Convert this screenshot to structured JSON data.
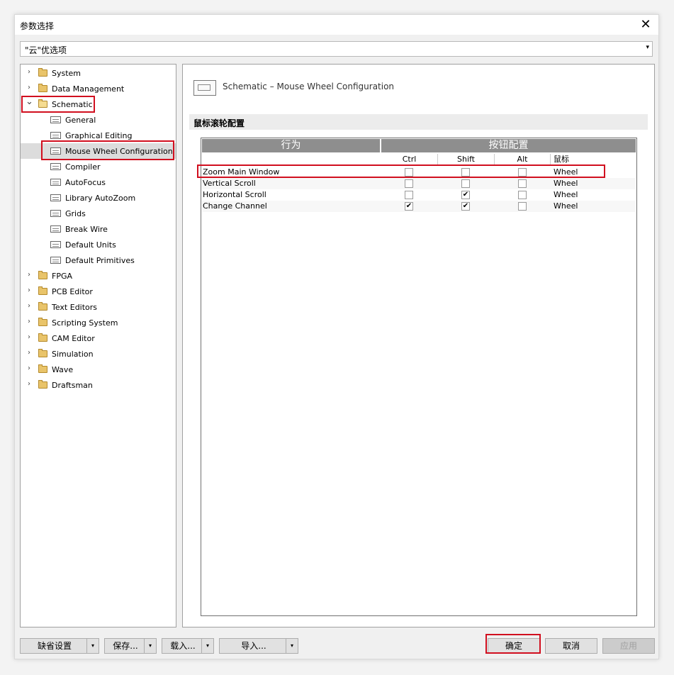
{
  "window": {
    "title": "参数选择",
    "close_glyph": "✕"
  },
  "profile": {
    "value": "\"云\"优选项",
    "arrow": "▾"
  },
  "tree": [
    {
      "label": "System",
      "kind": "folder",
      "level": 0,
      "expand": "collapsed"
    },
    {
      "label": "Data Management",
      "kind": "folder",
      "level": 0,
      "expand": "collapsed"
    },
    {
      "label": "Schematic",
      "kind": "folder",
      "level": 0,
      "expand": "expanded",
      "highlight": true
    },
    {
      "label": "General",
      "kind": "page",
      "level": 1
    },
    {
      "label": "Graphical Editing",
      "kind": "page",
      "level": 1
    },
    {
      "label": "Mouse Wheel Configuration",
      "kind": "page",
      "level": 1,
      "selected": true,
      "highlight": true
    },
    {
      "label": "Compiler",
      "kind": "page",
      "level": 1
    },
    {
      "label": "AutoFocus",
      "kind": "page",
      "level": 1
    },
    {
      "label": "Library AutoZoom",
      "kind": "page",
      "level": 1
    },
    {
      "label": "Grids",
      "kind": "page",
      "level": 1
    },
    {
      "label": "Break Wire",
      "kind": "page",
      "level": 1
    },
    {
      "label": "Default Units",
      "kind": "page",
      "level": 1
    },
    {
      "label": "Default Primitives",
      "kind": "page",
      "level": 1
    },
    {
      "label": "FPGA",
      "kind": "folder",
      "level": 0,
      "expand": "collapsed"
    },
    {
      "label": "PCB Editor",
      "kind": "folder",
      "level": 0,
      "expand": "collapsed"
    },
    {
      "label": "Text Editors",
      "kind": "folder",
      "level": 0,
      "expand": "collapsed"
    },
    {
      "label": "Scripting System",
      "kind": "folder",
      "level": 0,
      "expand": "collapsed"
    },
    {
      "label": "CAM Editor",
      "kind": "folder",
      "level": 0,
      "expand": "collapsed"
    },
    {
      "label": "Simulation",
      "kind": "folder",
      "level": 0,
      "expand": "collapsed"
    },
    {
      "label": "Wave",
      "kind": "folder",
      "level": 0,
      "expand": "collapsed"
    },
    {
      "label": "Draftsman",
      "kind": "folder",
      "level": 0,
      "expand": "collapsed"
    }
  ],
  "content": {
    "header_title": "Schematic – Mouse Wheel Configuration",
    "section_title": "鼠标滚轮配置",
    "grid": {
      "group_headers": [
        "行为",
        "按钮配置"
      ],
      "columns": [
        "Ctrl",
        "Shift",
        "Alt",
        "鼠标"
      ],
      "rows": [
        {
          "action": "Zoom Main Window",
          "ctrl": false,
          "shift": false,
          "alt": false,
          "mouse": "Wheel"
        },
        {
          "action": "Vertical Scroll",
          "ctrl": false,
          "shift": false,
          "alt": false,
          "mouse": "Wheel"
        },
        {
          "action": "Horizontal Scroll",
          "ctrl": false,
          "shift": true,
          "alt": false,
          "mouse": "Wheel"
        },
        {
          "action": "Change Channel",
          "ctrl": true,
          "shift": true,
          "alt": false,
          "mouse": "Wheel"
        }
      ]
    }
  },
  "buttons": {
    "defaults": "缺省设置",
    "save": "保存...",
    "load": "载入...",
    "import": "导入...",
    "ok": "确定",
    "cancel": "取消",
    "apply": "应用",
    "split_arrow": "▾"
  },
  "colors": {
    "highlight_red": "#d10f1f",
    "selection_bg": "#dcdcdc"
  }
}
